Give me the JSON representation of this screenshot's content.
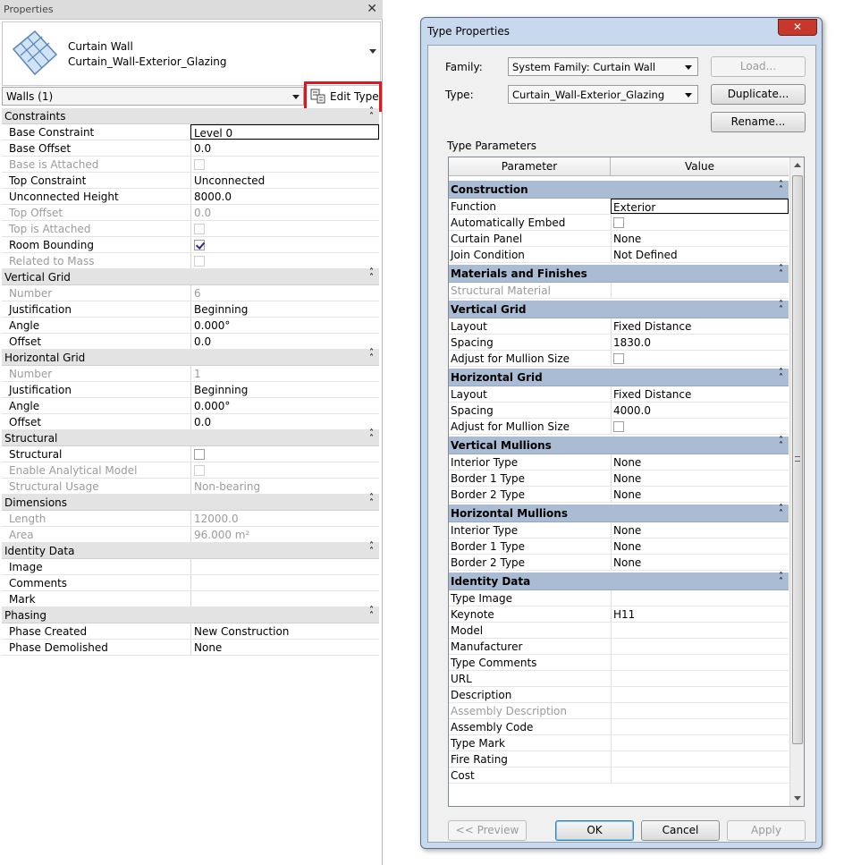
{
  "properties_panel": {
    "title": "Properties",
    "close": "✕",
    "type_family": "Curtain Wall",
    "type_name": "Curtain_Wall-Exterior_Glazing",
    "filter": "Walls (1)",
    "edit_type_label": "Edit Type",
    "sections": [
      {
        "header": "Constraints",
        "rows": [
          {
            "name": "Base Constraint",
            "value": "Level 0",
            "editing": true
          },
          {
            "name": "Base Offset",
            "value": "0.0"
          },
          {
            "name": "Base is Attached",
            "check": false,
            "disabled": true
          },
          {
            "name": "Top Constraint",
            "value": "Unconnected"
          },
          {
            "name": "Unconnected Height",
            "value": "8000.0"
          },
          {
            "name": "Top Offset",
            "value": "0.0",
            "disabled": true
          },
          {
            "name": "Top is Attached",
            "check": false,
            "disabled": true
          },
          {
            "name": "Room Bounding",
            "check": true
          },
          {
            "name": "Related to Mass",
            "check": false,
            "disabled": true
          }
        ]
      },
      {
        "header": "Vertical Grid",
        "rows": [
          {
            "name": "Number",
            "value": "6",
            "disabled": true
          },
          {
            "name": "Justification",
            "value": "Beginning"
          },
          {
            "name": "Angle",
            "value": "0.000°"
          },
          {
            "name": "Offset",
            "value": "0.0"
          }
        ]
      },
      {
        "header": "Horizontal Grid",
        "rows": [
          {
            "name": "Number",
            "value": "1",
            "disabled": true
          },
          {
            "name": "Justification",
            "value": "Beginning"
          },
          {
            "name": "Angle",
            "value": "0.000°"
          },
          {
            "name": "Offset",
            "value": "0.0"
          }
        ]
      },
      {
        "header": "Structural",
        "rows": [
          {
            "name": "Structural",
            "check": false
          },
          {
            "name": "Enable Analytical Model",
            "check": false,
            "disabled": true
          },
          {
            "name": "Structural Usage",
            "value": "Non-bearing",
            "disabled": true
          }
        ]
      },
      {
        "header": "Dimensions",
        "rows": [
          {
            "name": "Length",
            "value": "12000.0",
            "disabled": true
          },
          {
            "name": "Area",
            "value": "96.000 m²",
            "disabled": true
          }
        ]
      },
      {
        "header": "Identity Data",
        "rows": [
          {
            "name": "Image",
            "value": ""
          },
          {
            "name": "Comments",
            "value": ""
          },
          {
            "name": "Mark",
            "value": ""
          }
        ]
      },
      {
        "header": "Phasing",
        "rows": [
          {
            "name": "Phase Created",
            "value": "New Construction"
          },
          {
            "name": "Phase Demolished",
            "value": "None"
          }
        ]
      }
    ]
  },
  "dialog": {
    "title": "Type Properties",
    "close": "✕",
    "family_label": "Family:",
    "family_value": "System Family: Curtain Wall",
    "type_label": "Type:",
    "type_value": "Curtain_Wall-Exterior_Glazing",
    "load_label": "Load...",
    "duplicate_label": "Duplicate...",
    "rename_label": "Rename...",
    "type_parameters_label": "Type Parameters",
    "col_parameter": "Parameter",
    "col_value": "Value",
    "sections": [
      {
        "header": "Construction",
        "rows": [
          {
            "name": "Function",
            "value": "Exterior",
            "editing": true
          },
          {
            "name": "Automatically Embed",
            "check": false
          },
          {
            "name": "Curtain Panel",
            "value": "None"
          },
          {
            "name": "Join Condition",
            "value": "Not Defined"
          }
        ]
      },
      {
        "header": "Materials and Finishes",
        "rows": [
          {
            "name": "Structural Material",
            "value": "",
            "disabled": true
          }
        ]
      },
      {
        "header": "Vertical Grid",
        "rows": [
          {
            "name": "Layout",
            "value": "Fixed Distance"
          },
          {
            "name": "Spacing",
            "value": "1830.0"
          },
          {
            "name": "Adjust for Mullion Size",
            "check": false
          }
        ]
      },
      {
        "header": "Horizontal Grid",
        "rows": [
          {
            "name": "Layout",
            "value": "Fixed Distance"
          },
          {
            "name": "Spacing",
            "value": "4000.0"
          },
          {
            "name": "Adjust for Mullion Size",
            "check": false
          }
        ]
      },
      {
        "header": "Vertical Mullions",
        "rows": [
          {
            "name": "Interior Type",
            "value": "None"
          },
          {
            "name": "Border 1 Type",
            "value": "None"
          },
          {
            "name": "Border 2 Type",
            "value": "None"
          }
        ]
      },
      {
        "header": "Horizontal Mullions",
        "rows": [
          {
            "name": "Interior Type",
            "value": "None"
          },
          {
            "name": "Border 1 Type",
            "value": "None"
          },
          {
            "name": "Border 2 Type",
            "value": "None"
          }
        ]
      },
      {
        "header": "Identity Data",
        "rows": [
          {
            "name": "Type Image",
            "value": ""
          },
          {
            "name": "Keynote",
            "value": "H11"
          },
          {
            "name": "Model",
            "value": ""
          },
          {
            "name": "Manufacturer",
            "value": ""
          },
          {
            "name": "Type Comments",
            "value": ""
          },
          {
            "name": "URL",
            "value": ""
          },
          {
            "name": "Description",
            "value": ""
          },
          {
            "name": "Assembly Description",
            "value": "",
            "disabled": true
          },
          {
            "name": "Assembly Code",
            "value": ""
          },
          {
            "name": "Type Mark",
            "value": ""
          },
          {
            "name": "Fire Rating",
            "value": ""
          },
          {
            "name": "Cost",
            "value": ""
          }
        ]
      }
    ],
    "preview_label": "<< Preview",
    "ok_label": "OK",
    "cancel_label": "Cancel",
    "apply_label": "Apply"
  },
  "colors": {
    "highlight_box": "#e0151d",
    "dialog_frame": "#c8d9ee",
    "section_header": "#aabcd3",
    "close_button": "#c8372c"
  },
  "icons": [
    "curtain-wall-thumbnail-icon",
    "edit-type-icon",
    "collapse-icon",
    "chevron-down-icon",
    "close-icon",
    "checkbox-icon"
  ]
}
